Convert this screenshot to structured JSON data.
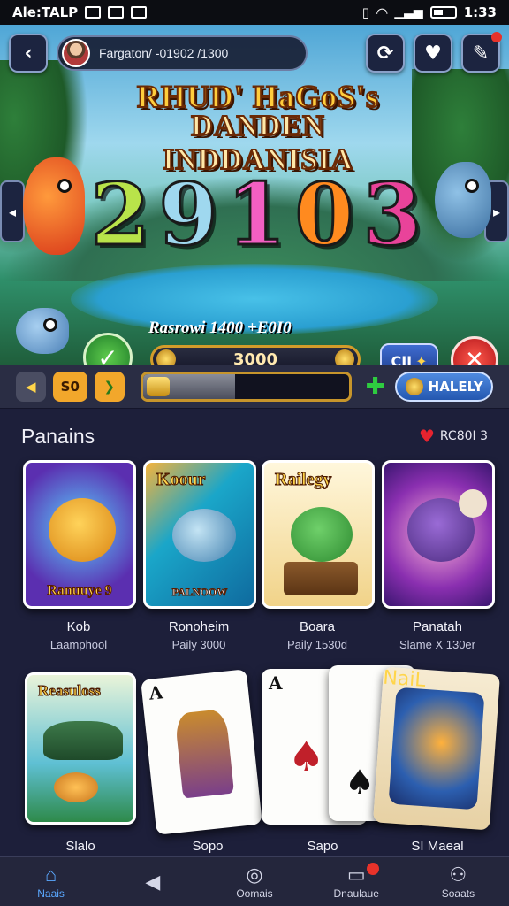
{
  "status_bar": {
    "carrier": "Ale:TALP",
    "time": "1:33"
  },
  "header": {
    "back_icon": "chevron-left",
    "user_text": "Fargaton/ -01902 /1300",
    "icons": [
      "refresh-icon",
      "heart-icon",
      "edit-icon"
    ]
  },
  "hero": {
    "title_line1": "RHUD' HaGoS's",
    "title_line2": "DANDEN INDDANISIA",
    "digits": [
      "2",
      "9",
      "1",
      "0",
      "3"
    ],
    "jackpot_label": "Rasrowi 1400 +E0I0",
    "jackpot_value": "3000",
    "action_label": "CII",
    "side_left": "◂",
    "side_right": "▸"
  },
  "controls": {
    "left_label": "◀",
    "bet_label": "S0",
    "arrow_label": "❯",
    "progress": 0.45,
    "tag_label": "HALELY"
  },
  "games_section": {
    "title": "Panains",
    "right_label": "RC80I 3"
  },
  "games": [
    {
      "card_text": "Ranuuye 9",
      "name": "Kob",
      "sub": "Laamphool"
    },
    {
      "card_text": "Koour",
      "card_sub": "PALNOOW",
      "name": "Ronoheim",
      "sub": "Paily 3000"
    },
    {
      "card_text": "Railegy",
      "name": "Boara",
      "sub": "Paily 1530d"
    },
    {
      "card_text": "",
      "name": "Panatah",
      "sub": "Slame X 130er"
    }
  ],
  "row2": [
    {
      "card_text": "Reasuloss",
      "name": "Slalo"
    },
    {
      "card_text": "A",
      "name": "Sopo"
    },
    {
      "card_text": "A",
      "name": "Sapo"
    },
    {
      "card_text": "NaiL",
      "name": "SI Maeal"
    }
  ],
  "nav": [
    {
      "label": "Naais",
      "icon": "home-icon"
    },
    {
      "label": "",
      "icon": "back-icon"
    },
    {
      "label": "Oomais",
      "icon": "chip-icon"
    },
    {
      "label": "Dnaulaue",
      "icon": "inbox-icon"
    },
    {
      "label": "Soaats",
      "icon": "user-icon"
    }
  ],
  "colors": {
    "accent": "#d39c2a",
    "nav_active": "#5aa8ff",
    "danger": "#e8322a",
    "bg": "#1d1f3a"
  }
}
